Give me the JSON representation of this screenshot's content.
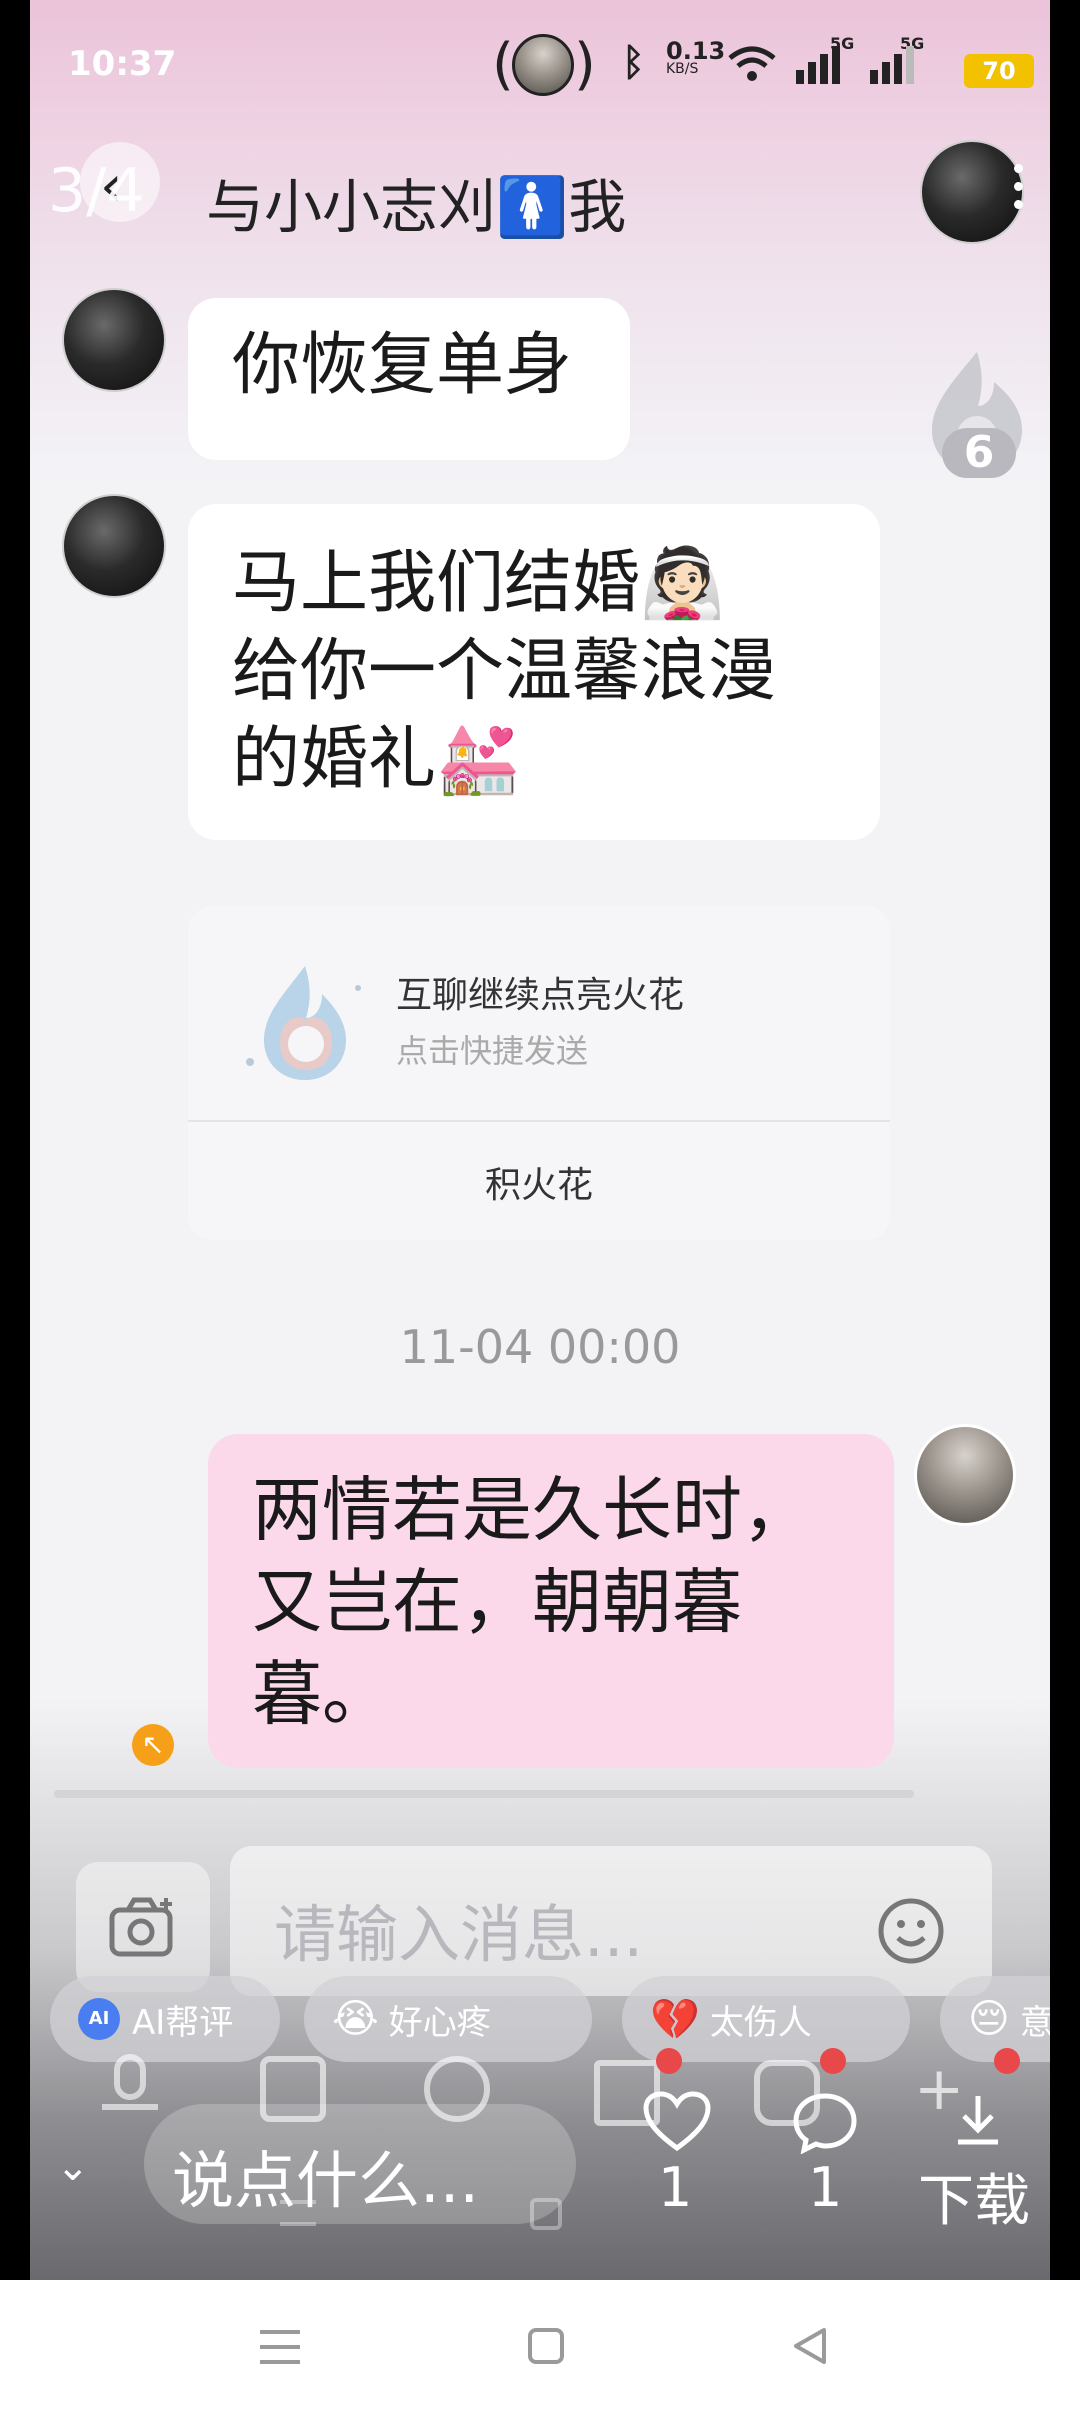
{
  "status_bar": {
    "time": "10:37",
    "speed_value": "0.13",
    "speed_unit": "KB/S",
    "net1": "5G",
    "net2": "5G",
    "battery": "70"
  },
  "header": {
    "page_counter": "3/4",
    "title": "与小小志刈🚺我"
  },
  "messages": {
    "m1": "你恢复单身",
    "m2_line1": "马上我们结婚👰🏻",
    "m2_line2": "给你一个温馨浪漫",
    "m2_line3": "的婚礼💒",
    "spark_card": {
      "title": "互聊继续点亮火花",
      "subtitle": "点击快捷发送",
      "action": "积火花"
    },
    "timestamp": "11-04 00:00",
    "m3_line1": "两情若是久长时，",
    "m3_line2": "又岂在，朝朝暮",
    "m3_line3": "暮。"
  },
  "spark_badge": {
    "count": "6"
  },
  "input": {
    "placeholder": "请输入消息..."
  },
  "quick_replies": [
    {
      "icon": "ai-icon",
      "label": "AI帮评"
    },
    {
      "icon": "😭",
      "label": "好心疼"
    },
    {
      "icon": "💔",
      "label": "太伤人"
    },
    {
      "icon": "😔",
      "label": "意"
    }
  ],
  "bottom_bar": {
    "say_something": "说点什么...",
    "like_count": "1",
    "comment_count": "1",
    "download_label": "下载"
  },
  "colors": {
    "outgoing_bubble": "#fbd9ea",
    "incoming_bubble": "#ffffff",
    "battery": "#f2c200",
    "accent_orange": "#f5a018",
    "red_dot": "#e8484a"
  }
}
